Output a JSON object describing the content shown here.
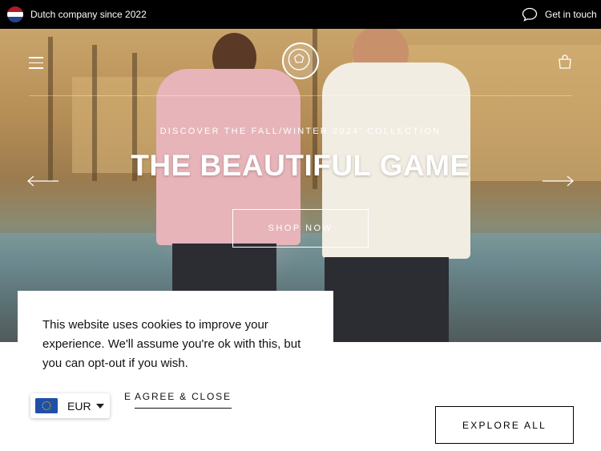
{
  "announcement": {
    "flag_icon": "netherlands-flag-icon",
    "text": "Dutch company since 2022",
    "contact_icon": "chat-bubble-icon",
    "contact_label": "Get in touch"
  },
  "header": {
    "menu_icon": "hamburger-menu-icon",
    "logo_icon": "football-crest-logo",
    "cart_icon": "shopping-bag-icon"
  },
  "hero": {
    "eyebrow": "DISCOVER THE FALL/WINTER 2024' COLLECTION",
    "headline": "THE BEAUTIFUL GAME",
    "cta_label": "SHOP NOW",
    "prev_icon": "arrow-left-icon",
    "next_icon": "arrow-right-icon"
  },
  "explore": {
    "label": "EXPLORE ALL"
  },
  "cookie": {
    "message": "This website uses cookies to improve your experience. We'll assume you're ok with this, but you can opt-out if you wish.",
    "opt_out_visible": "E",
    "agree_label": "AGREE & CLOSE"
  },
  "currency": {
    "flag_icon": "eu-flag-icon",
    "code": "EUR",
    "caret_icon": "caret-down-icon"
  },
  "colors": {
    "topbar_bg": "#000000",
    "text_dark": "#111111",
    "white": "#ffffff"
  }
}
